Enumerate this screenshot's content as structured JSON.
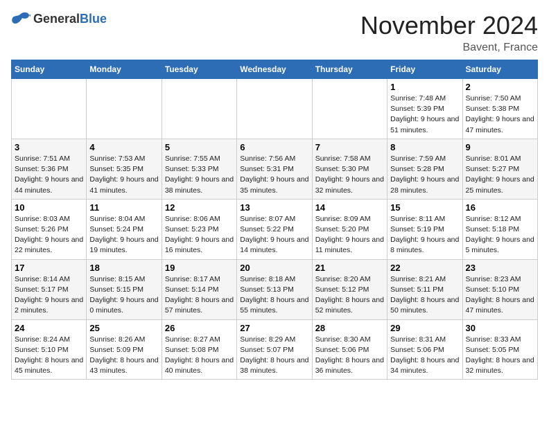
{
  "logo": {
    "general": "General",
    "blue": "Blue"
  },
  "header": {
    "title": "November 2024",
    "location": "Bavent, France"
  },
  "weekdays": [
    "Sunday",
    "Monday",
    "Tuesday",
    "Wednesday",
    "Thursday",
    "Friday",
    "Saturday"
  ],
  "weeks": [
    [
      {
        "day": "",
        "info": ""
      },
      {
        "day": "",
        "info": ""
      },
      {
        "day": "",
        "info": ""
      },
      {
        "day": "",
        "info": ""
      },
      {
        "day": "",
        "info": ""
      },
      {
        "day": "1",
        "info": "Sunrise: 7:48 AM\nSunset: 5:39 PM\nDaylight: 9 hours and 51 minutes."
      },
      {
        "day": "2",
        "info": "Sunrise: 7:50 AM\nSunset: 5:38 PM\nDaylight: 9 hours and 47 minutes."
      }
    ],
    [
      {
        "day": "3",
        "info": "Sunrise: 7:51 AM\nSunset: 5:36 PM\nDaylight: 9 hours and 44 minutes."
      },
      {
        "day": "4",
        "info": "Sunrise: 7:53 AM\nSunset: 5:35 PM\nDaylight: 9 hours and 41 minutes."
      },
      {
        "day": "5",
        "info": "Sunrise: 7:55 AM\nSunset: 5:33 PM\nDaylight: 9 hours and 38 minutes."
      },
      {
        "day": "6",
        "info": "Sunrise: 7:56 AM\nSunset: 5:31 PM\nDaylight: 9 hours and 35 minutes."
      },
      {
        "day": "7",
        "info": "Sunrise: 7:58 AM\nSunset: 5:30 PM\nDaylight: 9 hours and 32 minutes."
      },
      {
        "day": "8",
        "info": "Sunrise: 7:59 AM\nSunset: 5:28 PM\nDaylight: 9 hours and 28 minutes."
      },
      {
        "day": "9",
        "info": "Sunrise: 8:01 AM\nSunset: 5:27 PM\nDaylight: 9 hours and 25 minutes."
      }
    ],
    [
      {
        "day": "10",
        "info": "Sunrise: 8:03 AM\nSunset: 5:26 PM\nDaylight: 9 hours and 22 minutes."
      },
      {
        "day": "11",
        "info": "Sunrise: 8:04 AM\nSunset: 5:24 PM\nDaylight: 9 hours and 19 minutes."
      },
      {
        "day": "12",
        "info": "Sunrise: 8:06 AM\nSunset: 5:23 PM\nDaylight: 9 hours and 16 minutes."
      },
      {
        "day": "13",
        "info": "Sunrise: 8:07 AM\nSunset: 5:22 PM\nDaylight: 9 hours and 14 minutes."
      },
      {
        "day": "14",
        "info": "Sunrise: 8:09 AM\nSunset: 5:20 PM\nDaylight: 9 hours and 11 minutes."
      },
      {
        "day": "15",
        "info": "Sunrise: 8:11 AM\nSunset: 5:19 PM\nDaylight: 9 hours and 8 minutes."
      },
      {
        "day": "16",
        "info": "Sunrise: 8:12 AM\nSunset: 5:18 PM\nDaylight: 9 hours and 5 minutes."
      }
    ],
    [
      {
        "day": "17",
        "info": "Sunrise: 8:14 AM\nSunset: 5:17 PM\nDaylight: 9 hours and 2 minutes."
      },
      {
        "day": "18",
        "info": "Sunrise: 8:15 AM\nSunset: 5:15 PM\nDaylight: 9 hours and 0 minutes."
      },
      {
        "day": "19",
        "info": "Sunrise: 8:17 AM\nSunset: 5:14 PM\nDaylight: 8 hours and 57 minutes."
      },
      {
        "day": "20",
        "info": "Sunrise: 8:18 AM\nSunset: 5:13 PM\nDaylight: 8 hours and 55 minutes."
      },
      {
        "day": "21",
        "info": "Sunrise: 8:20 AM\nSunset: 5:12 PM\nDaylight: 8 hours and 52 minutes."
      },
      {
        "day": "22",
        "info": "Sunrise: 8:21 AM\nSunset: 5:11 PM\nDaylight: 8 hours and 50 minutes."
      },
      {
        "day": "23",
        "info": "Sunrise: 8:23 AM\nSunset: 5:10 PM\nDaylight: 8 hours and 47 minutes."
      }
    ],
    [
      {
        "day": "24",
        "info": "Sunrise: 8:24 AM\nSunset: 5:10 PM\nDaylight: 8 hours and 45 minutes."
      },
      {
        "day": "25",
        "info": "Sunrise: 8:26 AM\nSunset: 5:09 PM\nDaylight: 8 hours and 43 minutes."
      },
      {
        "day": "26",
        "info": "Sunrise: 8:27 AM\nSunset: 5:08 PM\nDaylight: 8 hours and 40 minutes."
      },
      {
        "day": "27",
        "info": "Sunrise: 8:29 AM\nSunset: 5:07 PM\nDaylight: 8 hours and 38 minutes."
      },
      {
        "day": "28",
        "info": "Sunrise: 8:30 AM\nSunset: 5:06 PM\nDaylight: 8 hours and 36 minutes."
      },
      {
        "day": "29",
        "info": "Sunrise: 8:31 AM\nSunset: 5:06 PM\nDaylight: 8 hours and 34 minutes."
      },
      {
        "day": "30",
        "info": "Sunrise: 8:33 AM\nSunset: 5:05 PM\nDaylight: 8 hours and 32 minutes."
      }
    ]
  ]
}
